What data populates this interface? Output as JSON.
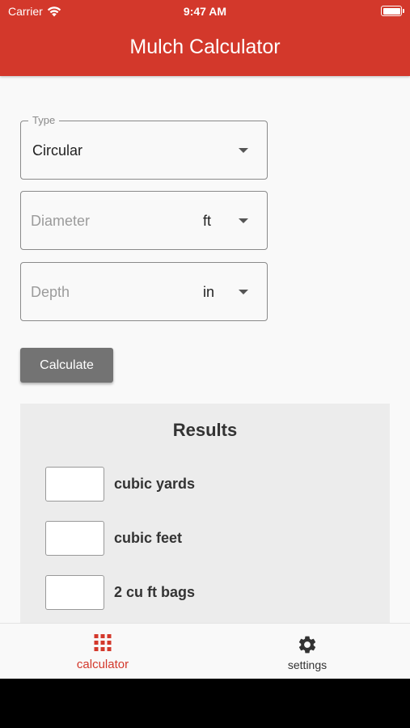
{
  "status_bar": {
    "carrier": "Carrier",
    "time": "9:47 AM"
  },
  "header": {
    "title": "Mulch Calculator"
  },
  "form": {
    "type": {
      "legend": "Type",
      "value": "Circular"
    },
    "diameter": {
      "placeholder": "Diameter",
      "unit": "ft"
    },
    "depth": {
      "placeholder": "Depth",
      "unit": "in"
    },
    "calculate_label": "Calculate"
  },
  "results": {
    "title": "Results",
    "rows": [
      {
        "label": "cubic yards",
        "value": ""
      },
      {
        "label": "cubic feet",
        "value": ""
      },
      {
        "label": "2 cu ft bags",
        "value": ""
      }
    ]
  },
  "tabbar": {
    "items": [
      {
        "label": "calculator",
        "icon": "grid-icon",
        "active": true
      },
      {
        "label": "settings",
        "icon": "gear-icon",
        "active": false
      }
    ]
  },
  "colors": {
    "accent": "#d3382b",
    "button": "#737373",
    "results_bg": "#ececec"
  }
}
